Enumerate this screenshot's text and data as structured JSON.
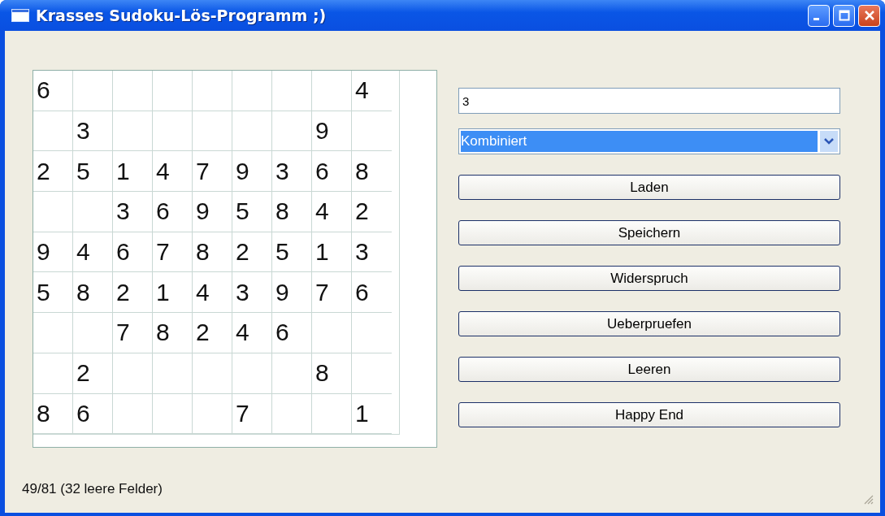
{
  "window": {
    "title": "Krasses Sudoku-Lös-Programm ;)"
  },
  "grid": {
    "rows": [
      [
        "6",
        null,
        null,
        null,
        null,
        null,
        null,
        null,
        "4"
      ],
      [
        null,
        "3",
        null,
        null,
        null,
        null,
        null,
        "9",
        null
      ],
      [
        "2",
        "5",
        "1",
        "4",
        "7",
        "9",
        "3",
        "6",
        "8"
      ],
      [
        null,
        null,
        "3",
        "6",
        "9",
        "5",
        "8",
        "4",
        "2"
      ],
      [
        "9",
        "4",
        "6",
        "7",
        "8",
        "2",
        "5",
        "1",
        "3"
      ],
      [
        "5",
        "8",
        "2",
        "1",
        "4",
        "3",
        "9",
        "7",
        "6"
      ],
      [
        null,
        null,
        "7",
        "8",
        "2",
        "4",
        "6",
        null,
        null
      ],
      [
        null,
        "2",
        null,
        null,
        null,
        null,
        null,
        "8",
        null
      ],
      [
        "8",
        "6",
        null,
        null,
        null,
        "7",
        null,
        null,
        "1"
      ]
    ]
  },
  "text_field": {
    "value": "3"
  },
  "dropdown": {
    "value": "Kombiniert",
    "selected": true
  },
  "buttons": [
    "Laden",
    "Speichern",
    "Widerspruch",
    "Ueberpruefen",
    "Leeren",
    "Happy End"
  ],
  "status_bar": {
    "text": "49/81 (32 leere Felder)"
  }
}
